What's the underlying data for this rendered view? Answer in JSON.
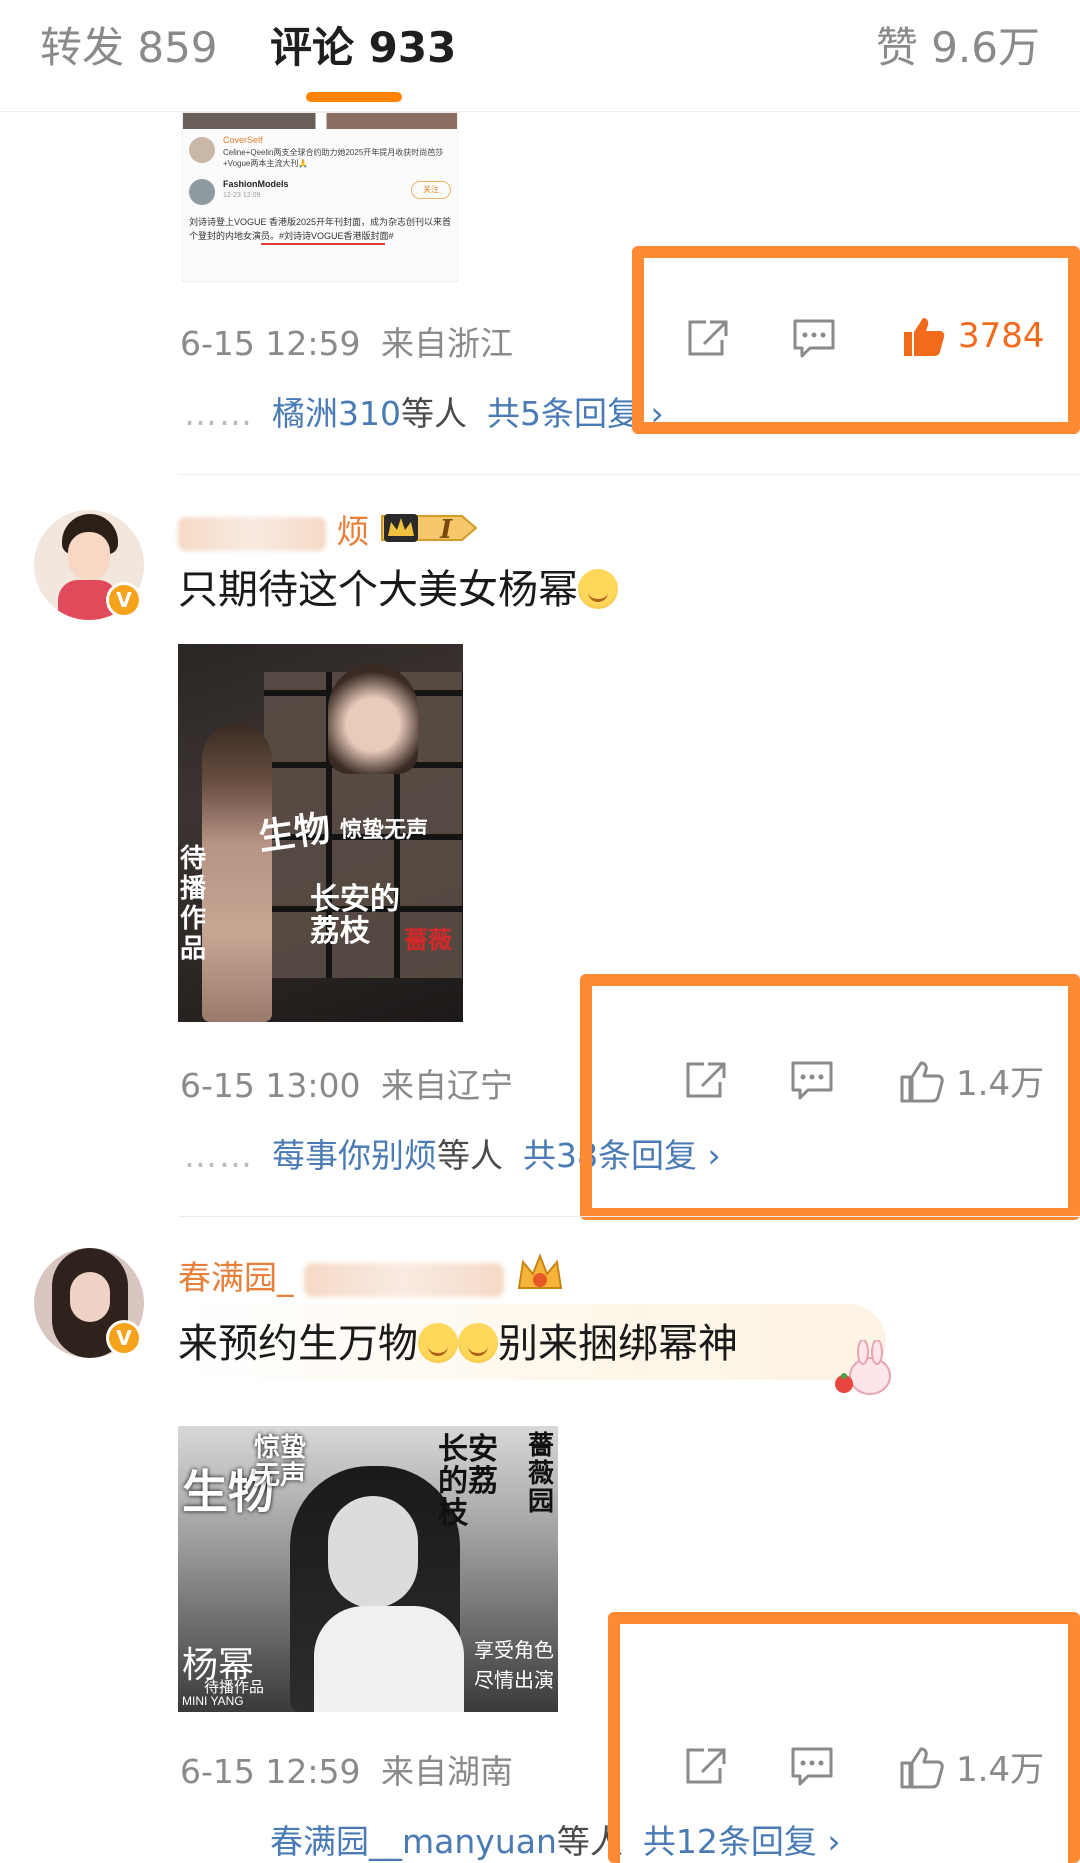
{
  "tabs": {
    "repost": "转发 859",
    "comments": "评论 933",
    "likes": "赞 9.6万"
  },
  "comment1": {
    "embedded": {
      "coverself_name": "CoverSelf",
      "coverself_text": "Celine+Qeelin两支全球合约助力她2025开年提月收获时尚芭莎+Vogue两本主流大刊🙏",
      "fashion_name": "FashionModels",
      "fashion_date": "12-23 12:09",
      "follow_label": "关注",
      "body_text": "刘诗诗登上VOGUE 香港版2025开年刊封面，成为杂志创刊以来首个登封的内地女演员。#刘诗诗VOGUE香港版封面#"
    },
    "time": "6-15 12:59",
    "location": "来自浙江",
    "likes": "3784",
    "reply_dots": "……",
    "reply_names": "橘洲310",
    "reply_suffix": "等人",
    "reply_total": "共5条回复 ›"
  },
  "comment2": {
    "username_tail": "烦",
    "level_badge": "I",
    "text": "只期待这个大美女杨幂",
    "poster_labels": [
      "生物",
      "惊蛰无声",
      "长安的荔枝",
      "薔薇",
      "待播作品"
    ],
    "time": "6-15 13:00",
    "location": "来自辽宁",
    "likes": "1.4万",
    "reply_dots": "……",
    "reply_names": "莓事你别烦",
    "reply_suffix": "等人",
    "reply_total": "共38条回复 ›"
  },
  "comment3": {
    "username_head": "春满园_",
    "text_before": "来预约生万物",
    "text_after": "别来捆绑幂神",
    "poster_labels": [
      "生物",
      "惊蛰无声",
      "长安的荔枝",
      "薔薇园",
      "杨幂",
      "待播作品",
      "MINI YANG",
      "享受角色",
      "尽情出演"
    ],
    "time": "6-15 12:59",
    "location": "来自湖南",
    "likes": "1.4万",
    "reply_names": "春满园__manyuan",
    "reply_suffix": "等人",
    "reply_total": "共12条回复 ›"
  },
  "colors": {
    "accent": "#ff8200",
    "highlight": "#ff8a33",
    "link": "#4a7bb4",
    "meta": "#8a8a8a",
    "like_active": "#f26b1d"
  },
  "icons": [
    "share-icon",
    "comment-icon",
    "thumbs-up-icon",
    "crown-icon",
    "verified-badge-icon"
  ]
}
